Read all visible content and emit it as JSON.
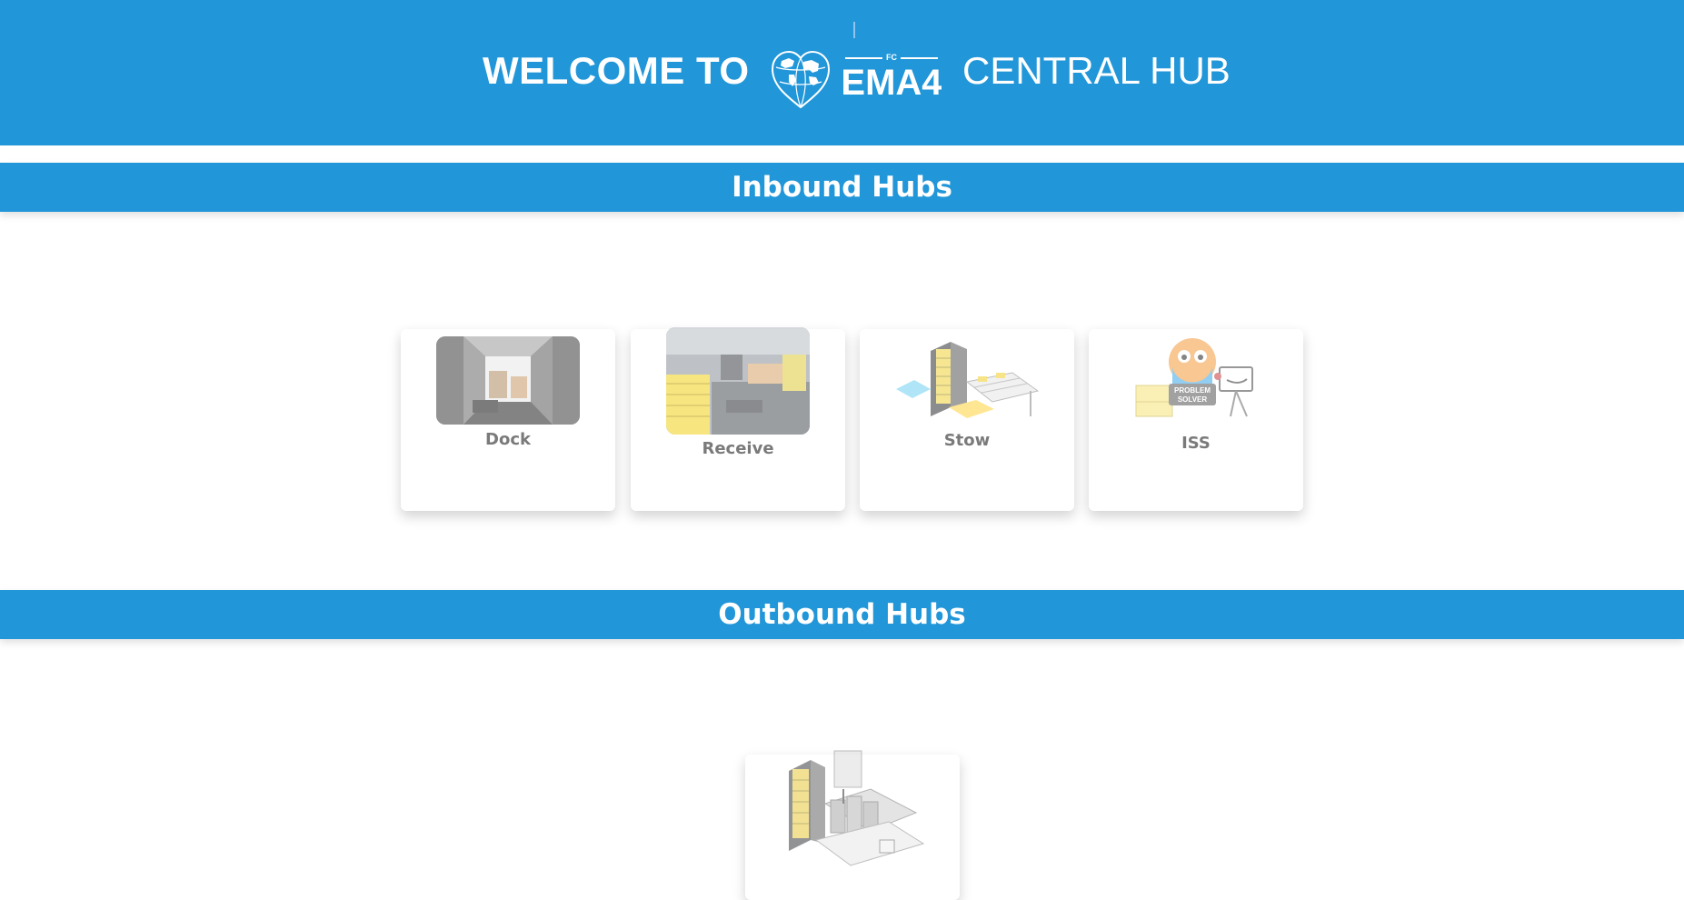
{
  "header": {
    "welcome_text": "WELCOME TO",
    "logo_superscript": "FC",
    "logo_text": "EMA4",
    "title_text": "CENTRAL HUB",
    "background_color": "#2196d8"
  },
  "sections": {
    "inbound": {
      "title": "Inbound Hubs"
    },
    "outbound": {
      "title": "Outbound Hubs"
    }
  },
  "inbound_cards": [
    {
      "label": "Dock",
      "icon": "dock-truck-image"
    },
    {
      "label": "Receive",
      "icon": "receive-station-image"
    },
    {
      "label": "Stow",
      "icon": "stow-station-image"
    },
    {
      "label": "ISS",
      "icon": "problem-solver-image"
    }
  ],
  "outbound_cards": [
    {
      "label": "",
      "icon": "pick-station-image"
    }
  ]
}
